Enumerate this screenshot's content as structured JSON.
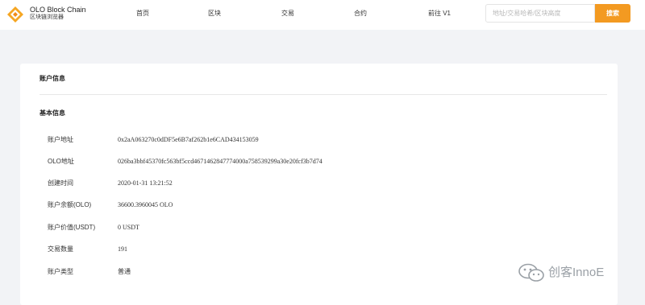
{
  "brand": {
    "name": "OLO Block Chain",
    "subtitle": "区块链浏览器"
  },
  "nav": {
    "items": [
      "首页",
      "区块",
      "交易",
      "合约",
      "前往 V1"
    ]
  },
  "search": {
    "placeholder": "地址/交易哈希/区块高度",
    "button_label": "搜索"
  },
  "account": {
    "card_title": "账户信息",
    "section_title": "基本信息",
    "rows": [
      {
        "label": "账户地址",
        "value": "0x2aA063270c0dDF5e6B7af262b1e6CAD434153059"
      },
      {
        "label": "OLO地址",
        "value": "026ba3bbf45370fc563bf5ccd4671462847774000a758539299a30e20fcf3b7d74"
      },
      {
        "label": "创建时间",
        "value": "2020-01-31 13:21:52"
      },
      {
        "label": "账户余额(OLO)",
        "value": "36600.3960045 OLO"
      },
      {
        "label": "账户价值(USDT)",
        "value": "0 USDT"
      },
      {
        "label": "交易数量",
        "value": "191"
      },
      {
        "label": "账户类型",
        "value": "普通"
      }
    ]
  },
  "watermark": {
    "text": "创客InnoE"
  },
  "colors": {
    "accent": "#f39a21",
    "page_bg": "#f2f3f6",
    "card_bg": "#ffffff"
  },
  "icons": {
    "logo": "olo-diamond-logo-icon",
    "watermark": "wechat-icon"
  }
}
